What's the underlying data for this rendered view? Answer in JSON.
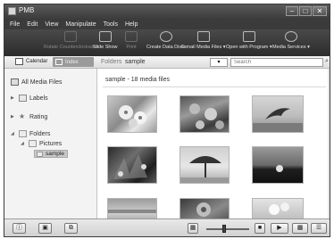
{
  "window": {
    "title": "PMB",
    "min_label": "–",
    "max_label": "□",
    "close_label": "✕"
  },
  "menu": [
    "File",
    "Edit",
    "View",
    "Manipulate",
    "Tools",
    "Help"
  ],
  "toolbar": {
    "rotate": "Rotate Counterclockwise",
    "slideshow": "Slide Show",
    "print": "Print",
    "create_disc": "Create Data Discs",
    "email": "E-mail Media Files ▾",
    "open_with": "Open with Program ▾",
    "media_services": "Media Services ▾"
  },
  "viewbar": {
    "calendar": "Calendar",
    "index": "Index",
    "folders_label": "Folders",
    "path": "sample",
    "sort": "▾",
    "search_placeholder": "Search"
  },
  "sidebar": {
    "all_media": "All Media Files",
    "labels": "Labels",
    "rating": "Rating",
    "folders": "Folders",
    "pictures": "Pictures",
    "sample": "sample"
  },
  "content": {
    "header": "sample - 18 media files"
  },
  "thumbnails": [
    {
      "subject": "flowers"
    },
    {
      "subject": "red flowers"
    },
    {
      "subject": "dolphin"
    },
    {
      "subject": "coastal plants"
    },
    {
      "subject": "beach umbrella"
    },
    {
      "subject": "sunset"
    },
    {
      "subject": "coast"
    },
    {
      "subject": "red flower"
    },
    {
      "subject": "white flowers"
    }
  ],
  "colors": {
    "dark_chrome": "#3b3b3b",
    "sidebar_bg": "#f3f3f3",
    "selected_bg": "#c8c8c8"
  }
}
